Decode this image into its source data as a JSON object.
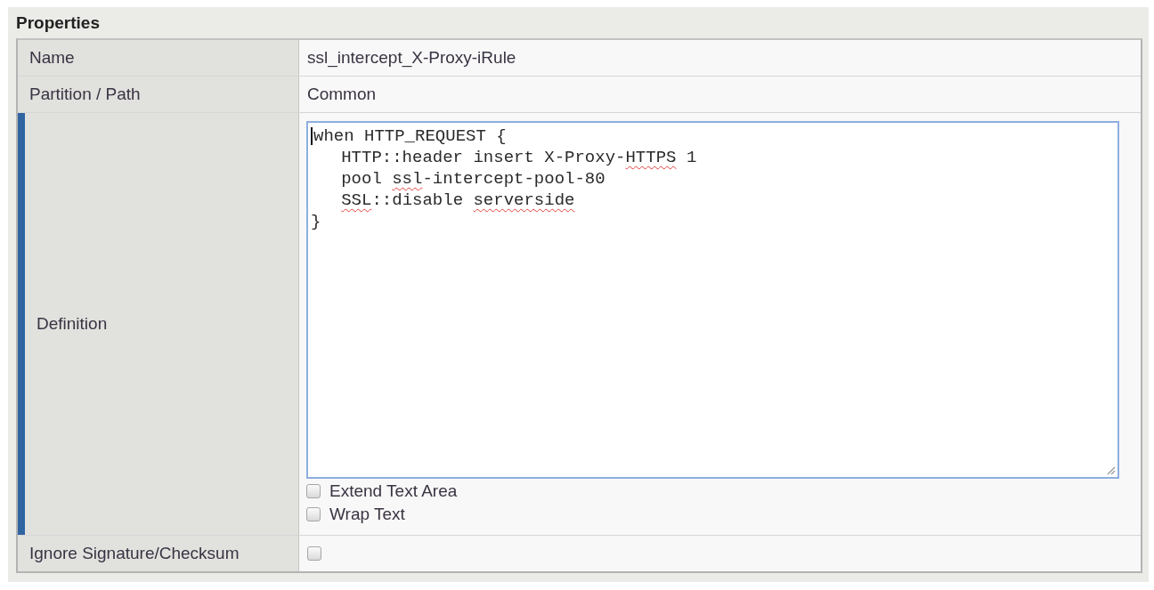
{
  "panel": {
    "title": "Properties",
    "rows": [
      {
        "kind": "text",
        "label": "Name",
        "required": false,
        "value": "ssl_intercept_X-Proxy-iRule"
      },
      {
        "kind": "text",
        "label": "Partition / Path",
        "required": false,
        "value": "Common"
      },
      {
        "kind": "code",
        "label": "Definition",
        "required": true,
        "focused": true,
        "lines": [
          {
            "indented": false,
            "segments": [
              {
                "text": "when HTTP_REQUEST {",
                "misspelled": false
              }
            ]
          },
          {
            "indented": true,
            "segments": [
              {
                "text": "HTTP::header insert X-Proxy-",
                "misspelled": false
              },
              {
                "text": "HTTPS",
                "misspelled": true
              },
              {
                "text": " 1",
                "misspelled": false
              }
            ]
          },
          {
            "indented": true,
            "segments": [
              {
                "text": "pool ",
                "misspelled": false
              },
              {
                "text": "ssl",
                "misspelled": true
              },
              {
                "text": "-intercept-pool-80",
                "misspelled": false
              }
            ]
          },
          {
            "indented": true,
            "segments": [
              {
                "text": "SSL",
                "misspelled": true
              },
              {
                "text": "::disable ",
                "misspelled": false
              },
              {
                "text": "serverside",
                "misspelled": true
              }
            ]
          },
          {
            "indented": false,
            "segments": [
              {
                "text": "}",
                "misspelled": false
              }
            ]
          }
        ],
        "options": [
          {
            "label": "Extend Text Area",
            "checked": false
          },
          {
            "label": "Wrap Text",
            "checked": false
          }
        ]
      },
      {
        "kind": "checkbox",
        "label": "Ignore Signature/Checksum",
        "required": false,
        "checked": false
      }
    ]
  }
}
